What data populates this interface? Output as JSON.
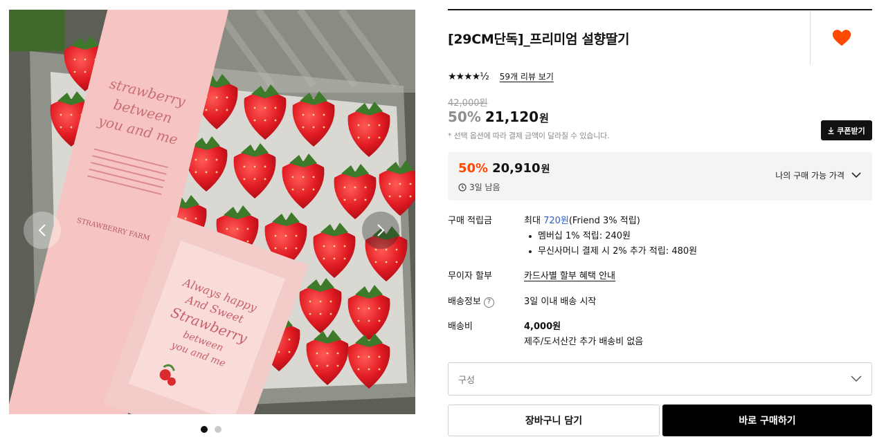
{
  "gallery": {
    "prev_icon": "chevron-left-icon",
    "next_icon": "chevron-right-icon",
    "dot_count": 2,
    "active_dot": 1
  },
  "product": {
    "title": "[29CM단독]_프리미엄 설향딸기",
    "wishlist_icon": "heart-icon",
    "wishlist_color": "#ff4800",
    "rating": 4.5,
    "stars_text": "★★★★½",
    "review_link": "59개 리뷰 보기",
    "original_price": "42,000원",
    "discount_pct": "50%",
    "sale_price": "21,120",
    "currency": "원",
    "notice": "* 선택 옵션에 따라 결제 금액이 달라질 수 있습니다.",
    "coupon_button": "쿠폰받기"
  },
  "best_price": {
    "discount_pct": "50%",
    "price": "20,910",
    "currency": "원",
    "timer": "3일 남음",
    "my_price_label": "나의 구매 가능 가격",
    "accent_color": "#ff4800"
  },
  "details": {
    "points_label": "구매 적립금",
    "points_prefix": "최대 ",
    "points_amount": "720원",
    "points_suffix": "(Friend 3% 적립)",
    "points_bullets": [
      "멤버십 1% 적립: 240원",
      "무신사머니 결제 시 2% 추가 적립: 480원"
    ],
    "installment_label": "무이자 할부",
    "installment_link": "카드사별 할부 혜택 안내",
    "shipping_info_label": "배송정보",
    "shipping_info_value": "3일 이내 배송 시작",
    "shipping_fee_label": "배송비",
    "shipping_fee_value": "4,000원",
    "shipping_fee_note": "제주/도서산간 추가 배송비 없음"
  },
  "option_select": {
    "placeholder": "구성"
  },
  "actions": {
    "cart_button": "장바구니 담기",
    "buy_button": "바로 구매하기"
  }
}
